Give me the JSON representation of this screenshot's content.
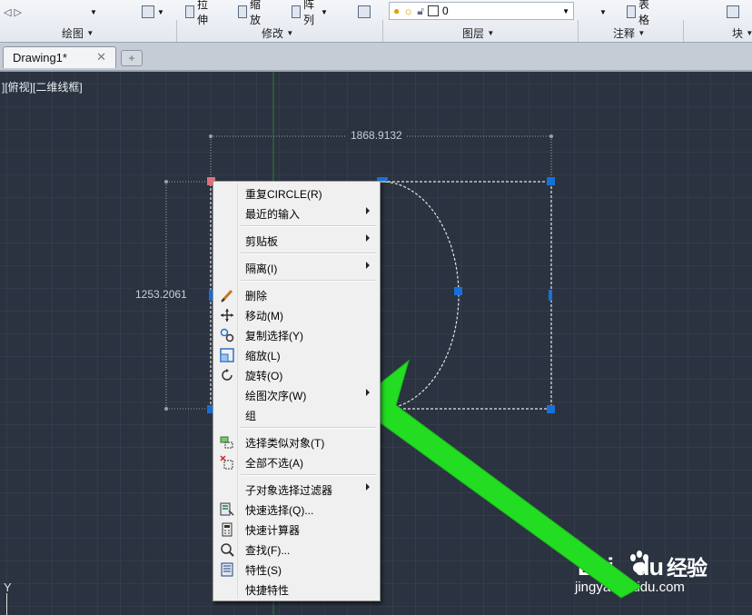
{
  "ribbon": {
    "tools": {
      "stretch": "拉伸",
      "scale": "缩放",
      "array": "阵列",
      "table": "表格",
      "layer_value": "0"
    },
    "sections": {
      "draw": "绘图",
      "modify": "修改",
      "layers": "图层",
      "annotate": "注释",
      "block": "块"
    }
  },
  "tabs": {
    "document": "Drawing1*",
    "close": "✕",
    "new": "+"
  },
  "viewport": {
    "label": "][俯视][二维线框]",
    "dim_horizontal": "1868.9132",
    "dim_vertical": "1253.2061",
    "ucs_y": "Y"
  },
  "context_menu": {
    "items": [
      {
        "label": "重复CIRCLE(R)"
      },
      {
        "label": "最近的输入"
      },
      {
        "label": "剪贴板"
      },
      {
        "label": "隔离(I)"
      },
      {
        "label": "删除"
      },
      {
        "label": "移动(M)"
      },
      {
        "label": "复制选择(Y)"
      },
      {
        "label": "缩放(L)"
      },
      {
        "label": "旋转(O)"
      },
      {
        "label": "绘图次序(W)"
      },
      {
        "label": "组"
      },
      {
        "label": "选择类似对象(T)"
      },
      {
        "label": "全部不选(A)"
      },
      {
        "label": "子对象选择过滤器"
      },
      {
        "label": "快速选择(Q)..."
      },
      {
        "label": "快速计算器"
      },
      {
        "label": "查找(F)..."
      },
      {
        "label": "特性(S)"
      },
      {
        "label": "快捷特性"
      }
    ]
  },
  "watermark": {
    "brand": "Bai",
    "brand_du": "du",
    "brand_cn": "经验",
    "url": "jingyan.baidu.com"
  },
  "colors": {
    "canvas": "#2b3340",
    "grip": "#1a6fd8",
    "hot_grip": "#e0707a",
    "arrow": "#22dd22"
  }
}
